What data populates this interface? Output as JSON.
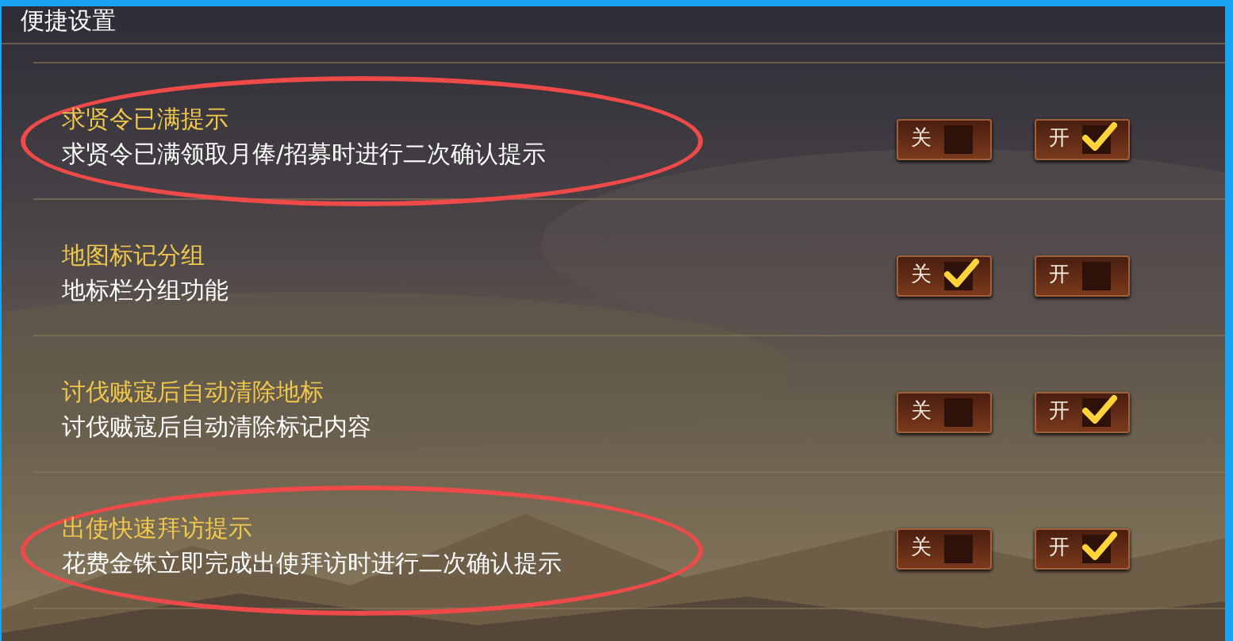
{
  "title": "便捷设置",
  "settings": [
    {
      "title": "求贤令已满提示",
      "description": "求贤令已满领取月俸/招募时进行二次确认提示",
      "highlighted": true,
      "options": [
        {
          "label": "关",
          "selected": false
        },
        {
          "label": "开",
          "selected": true
        }
      ]
    },
    {
      "title": "地图标记分组",
      "description": "地标栏分组功能",
      "highlighted": false,
      "options": [
        {
          "label": "关",
          "selected": true
        },
        {
          "label": "开",
          "selected": false
        }
      ]
    },
    {
      "title": "讨伐贼寇后自动清除地标",
      "description": "讨伐贼寇后自动清除标记内容",
      "highlighted": false,
      "options": [
        {
          "label": "关",
          "selected": false
        },
        {
          "label": "开",
          "selected": true
        }
      ]
    },
    {
      "title": "出使快速拜访提示",
      "description": "花费金铢立即完成出使拜访时进行二次确认提示",
      "highlighted": true,
      "options": [
        {
          "label": "关",
          "selected": false
        },
        {
          "label": "开",
          "selected": true
        }
      ]
    }
  ]
}
